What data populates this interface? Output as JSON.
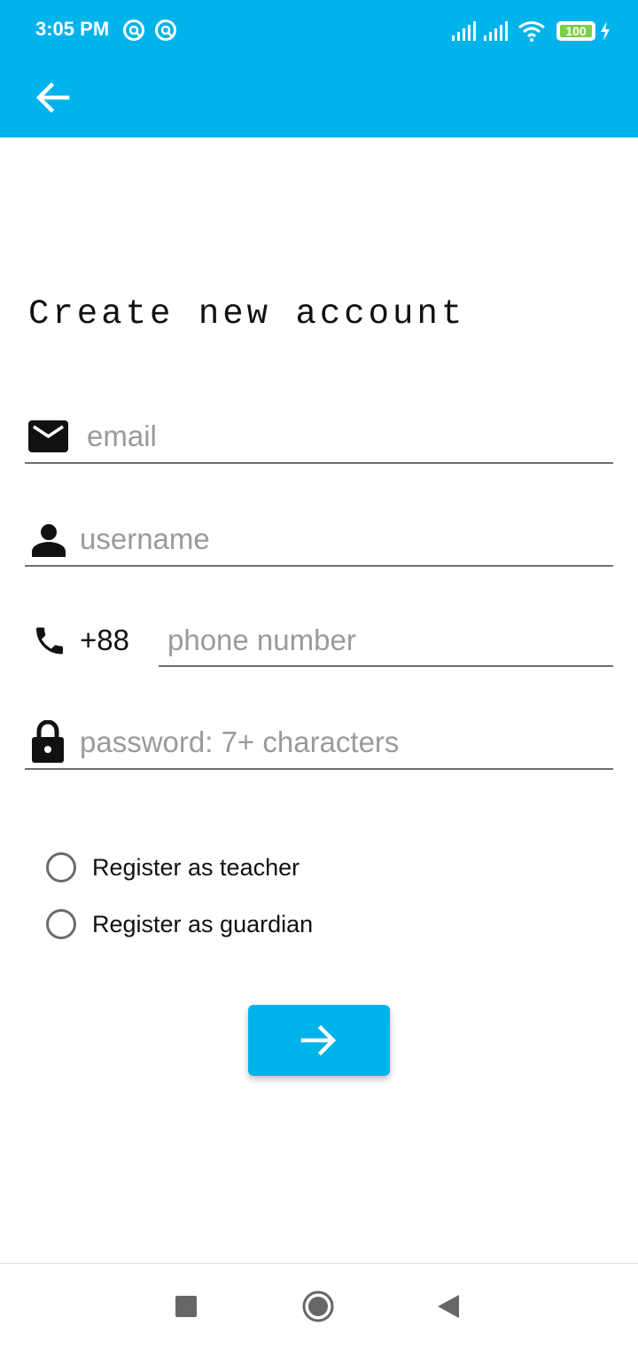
{
  "status_bar": {
    "time": "3:05 PM",
    "battery": "100",
    "icons": [
      "notification-icon",
      "notification-icon",
      "signal-icon",
      "signal-icon",
      "wifi-icon",
      "battery-icon",
      "charging-icon"
    ]
  },
  "app_bar": {
    "back_icon": "arrow-left-icon",
    "color": "#00b3ea"
  },
  "form": {
    "title": "Create new account",
    "email": {
      "placeholder": "email",
      "value": "",
      "icon": "mail-icon"
    },
    "username": {
      "placeholder": "username",
      "value": "",
      "icon": "person-icon"
    },
    "phone": {
      "country_code": "+88",
      "placeholder": "phone number",
      "value": "",
      "icon": "phone-icon"
    },
    "password": {
      "placeholder": "password: 7+ characters",
      "value": "",
      "icon": "lock-icon"
    },
    "roles": [
      {
        "label": "Register as teacher",
        "selected": false
      },
      {
        "label": "Register as guardian",
        "selected": false
      }
    ],
    "submit_icon": "arrow-right-icon"
  },
  "nav_bar": {
    "icons": [
      "recents-square-icon",
      "home-circle-icon",
      "back-triangle-icon"
    ]
  }
}
